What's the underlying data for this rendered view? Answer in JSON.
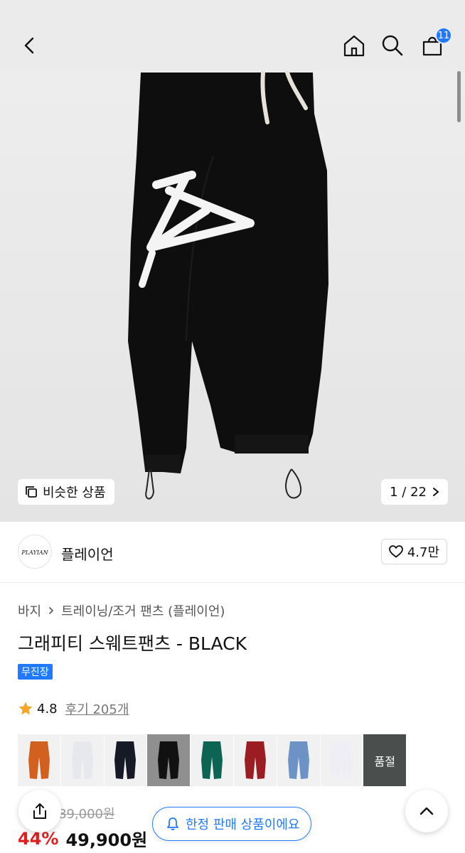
{
  "header": {
    "back_icon": "chevron-left-icon",
    "home_icon": "home-icon",
    "search_icon": "search-icon",
    "cart_icon": "cart-icon",
    "cart_count": "11"
  },
  "gallery": {
    "similar_label": "비슷한 상품",
    "page_counter": "1 / 22"
  },
  "brand": {
    "name": "플레이언",
    "logo_text": "PLAYIAN",
    "likes": "4.7만"
  },
  "breadcrumb": [
    "바지",
    "트레이닝/조거 팬츠 (플레이언)"
  ],
  "product": {
    "title": "그래피티 스웨트팬츠 - BLACK",
    "badge": "무진장",
    "rating": "4.8",
    "reviews": "후기 205개",
    "thumbs": [
      {
        "color": "#d2601f",
        "state": "normal",
        "label": ""
      },
      {
        "color": "#e7e7ee",
        "state": "normal",
        "label": ""
      },
      {
        "color": "#161a26",
        "state": "normal",
        "label": ""
      },
      {
        "color": "#111111",
        "state": "selected",
        "label": ""
      },
      {
        "color": "#0e6452",
        "state": "normal",
        "label": ""
      },
      {
        "color": "#9c1c24",
        "state": "normal",
        "label": ""
      },
      {
        "color": "#6d93c6",
        "state": "normal",
        "label": ""
      },
      {
        "color": "#eeeef4",
        "state": "normal",
        "label": ""
      },
      {
        "color": "#2f3431",
        "state": "soldout",
        "label": "품절"
      }
    ],
    "original_price": "89,000원",
    "discount": "44%",
    "price": "49,900원"
  },
  "floating": {
    "limited_label": "한정 판매 상품이에요",
    "share_icon": "share-icon",
    "up_icon": "chevron-up-icon",
    "bell_icon": "bell-icon"
  }
}
